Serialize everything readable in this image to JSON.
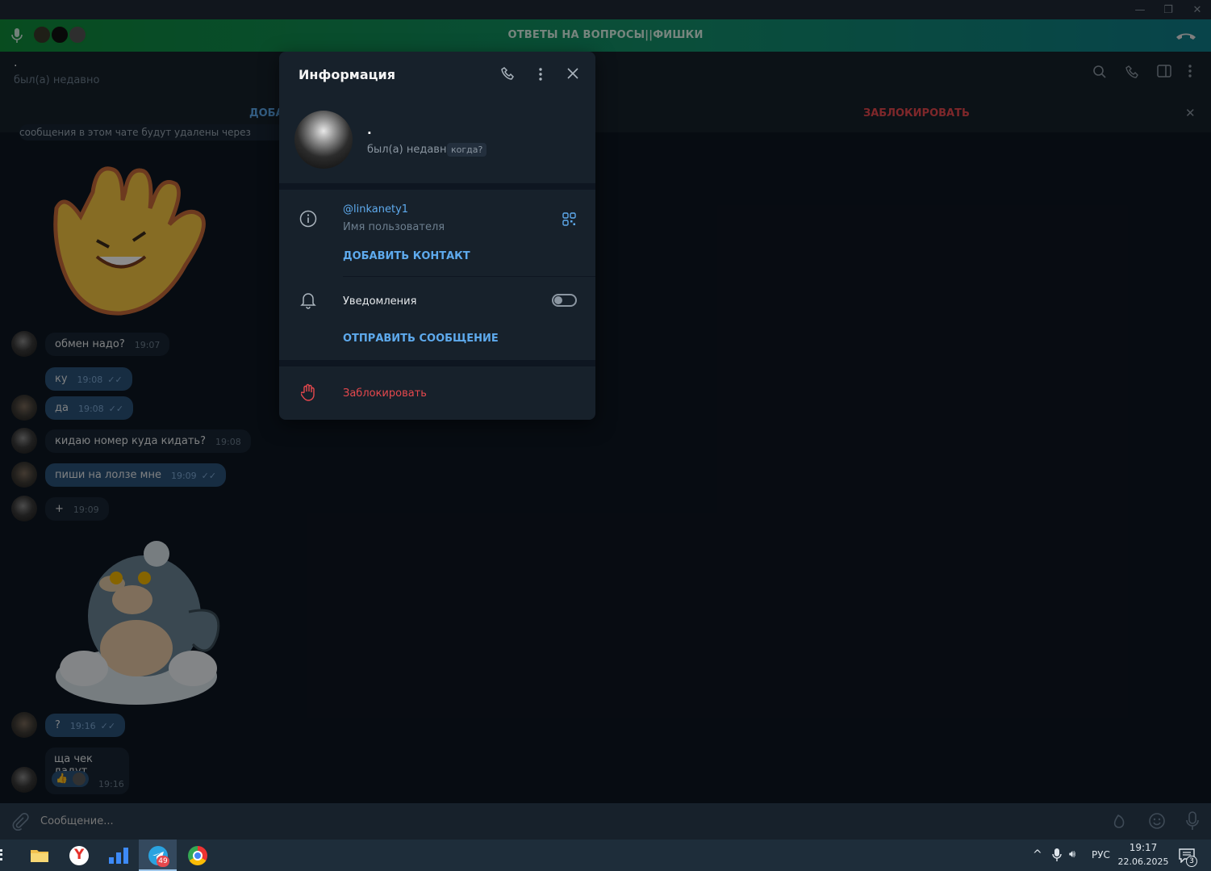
{
  "call": {
    "title": "ОТВЕТЫ НА ВОПРОСЫ||ФИШКИ"
  },
  "chat": {
    "name": ".",
    "status": "был(а) недавно"
  },
  "actions": {
    "add": "ДОБА",
    "block": "ЗАБЛОКИРОВАТЬ",
    "notice": "сообщения в этом чате будут удалены через"
  },
  "messages": [
    {
      "text": "обмен надо?",
      "time": "19:07",
      "out": false
    },
    {
      "text": "ку",
      "time": "19:08",
      "out": true
    },
    {
      "text": "да",
      "time": "19:08",
      "out": true
    },
    {
      "text": "кидаю номер куда кидать?",
      "time": "19:08",
      "out": false
    },
    {
      "text": "пиши на лолзе мне",
      "time": "19:09",
      "out": true
    },
    {
      "text": "+",
      "time": "19:09",
      "out": false
    },
    {
      "text": "?",
      "time": "19:16",
      "out": true
    },
    {
      "text": "ща чек дадут",
      "time": "19:16",
      "out": false
    }
  ],
  "input": {
    "placeholder": "Сообщение..."
  },
  "modal": {
    "title": "Информация",
    "name": ".",
    "status": "был(а) недавно",
    "when": "когда?",
    "username": "@linkanety1",
    "username_label": "Имя пользователя",
    "add_contact": "ДОБАВИТЬ КОНТАКТ",
    "notifications": "Уведомления",
    "send_message": "ОТПРАВИТЬ СООБЩЕНИЕ",
    "block": "Заблокировать"
  },
  "taskbar": {
    "lang": "РУС",
    "time": "19:17",
    "date": "22.06.2025",
    "telegram_badge": "49",
    "notif_count": "3"
  },
  "colors": {
    "accent": "#5eaaed",
    "danger": "#e5484d",
    "call_green": "#0f8a3a"
  }
}
